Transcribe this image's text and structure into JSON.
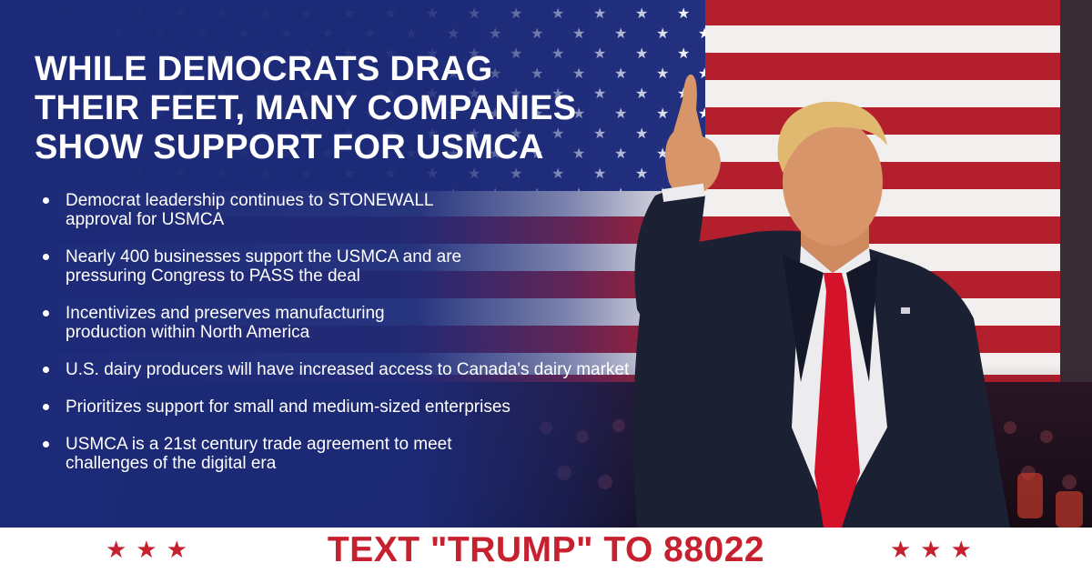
{
  "headline": {
    "lines": [
      "WHILE DEMOCRATS DRAG",
      "THEIR FEET, MANY COMPANIES",
      "SHOW SUPPORT FOR USMCA"
    ]
  },
  "bullets": [
    {
      "line1": "Democrat leadership continues to STONEWALL",
      "line2": "approval for USMCA"
    },
    {
      "line1": "Nearly 400 businesses support the USMCA and are",
      "line2": "pressuring Congress to PASS the deal"
    },
    {
      "line1": "Incentivizes and preserves manufacturing",
      "line2": "production within North America"
    },
    {
      "line1": "U.S. dairy producers will have increased access to Canada's dairy market",
      "line2": ""
    },
    {
      "line1": "Prioritizes support for small and medium-sized enterprises",
      "line2": ""
    },
    {
      "line1": "USMCA is a 21st century trade agreement to meet",
      "line2": "challenges of the digital era"
    }
  ],
  "footer": {
    "cta": "TEXT \"TRUMP\" TO 88022",
    "stars_left": "★★★",
    "stars_right": "★★★"
  },
  "colors": {
    "background_blue": "#1c2a78",
    "flag_red": "#b41f2e",
    "cta_red": "#c7202f",
    "white": "#ffffff"
  }
}
